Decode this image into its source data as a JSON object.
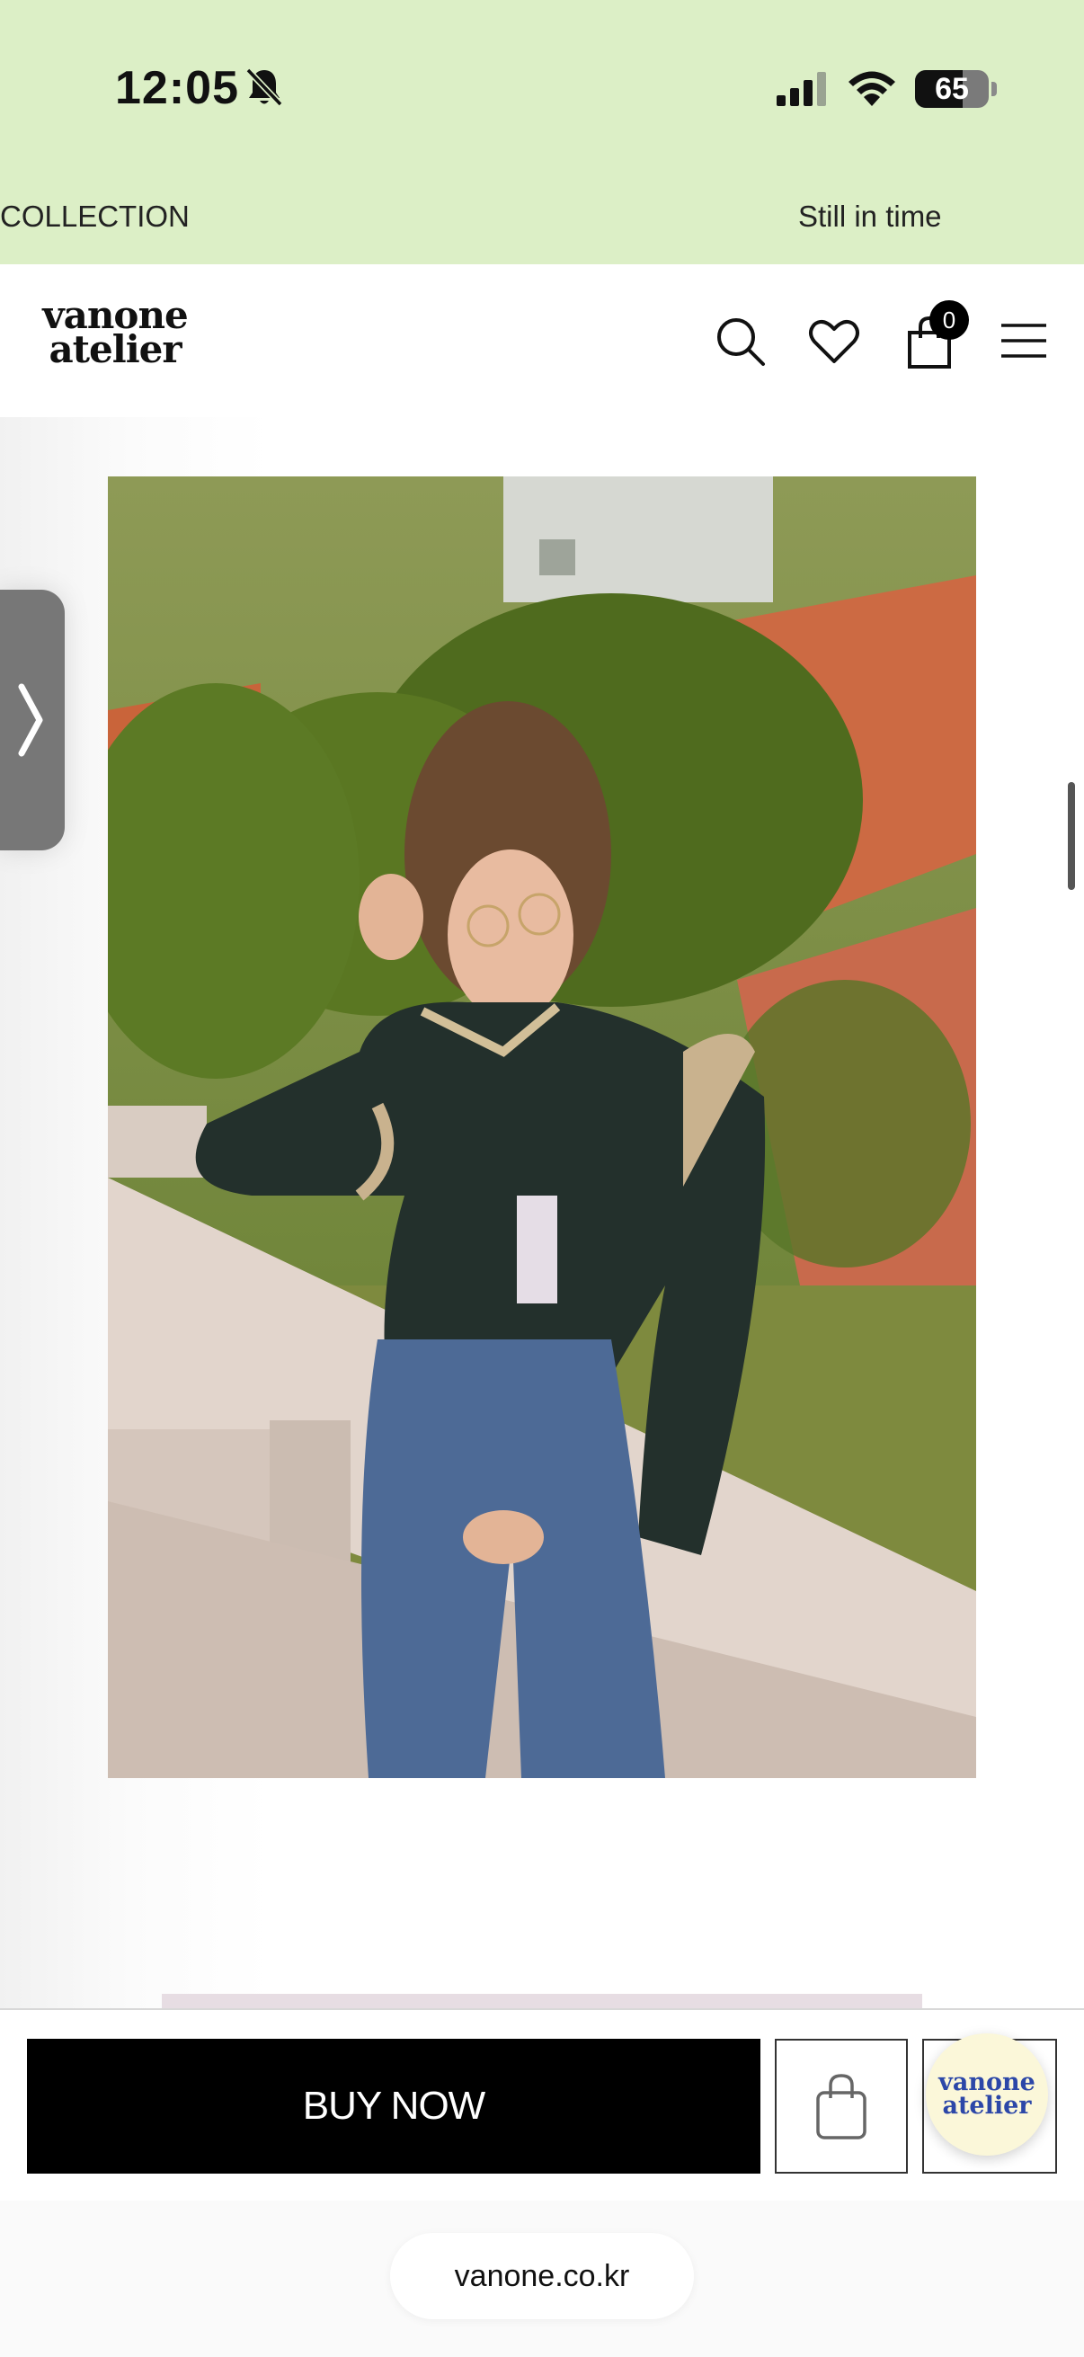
{
  "status_bar": {
    "time": "12:05",
    "battery": "65",
    "battery_level": 0.65,
    "icons": [
      "bell-slash-icon",
      "cellular-signal-icon",
      "wifi-icon",
      "battery-icon"
    ]
  },
  "marquee": {
    "left_text": "COLLECTION",
    "right_text": "Still in time"
  },
  "header": {
    "logo_line1": "vanone",
    "logo_line2": "atelier",
    "cart_count": "0",
    "icons": [
      "search-icon",
      "heart-icon",
      "shopping-bag-icon",
      "hamburger-menu-icon"
    ]
  },
  "side_tab": {
    "icon": "chevron-right-icon"
  },
  "bottom_bar": {
    "buy_now_label": "BUY NOW",
    "cart_icon": "shopping-bag-icon",
    "chat_logo_line1": "vanone",
    "chat_logo_line2": "atelier"
  },
  "browser": {
    "url": "vanone.co.kr"
  },
  "colors": {
    "top_band": "#dcefc6",
    "buy_button": "#000000",
    "chat_bubble": "#fbf7d9",
    "chat_logo": "#2c47a8"
  }
}
